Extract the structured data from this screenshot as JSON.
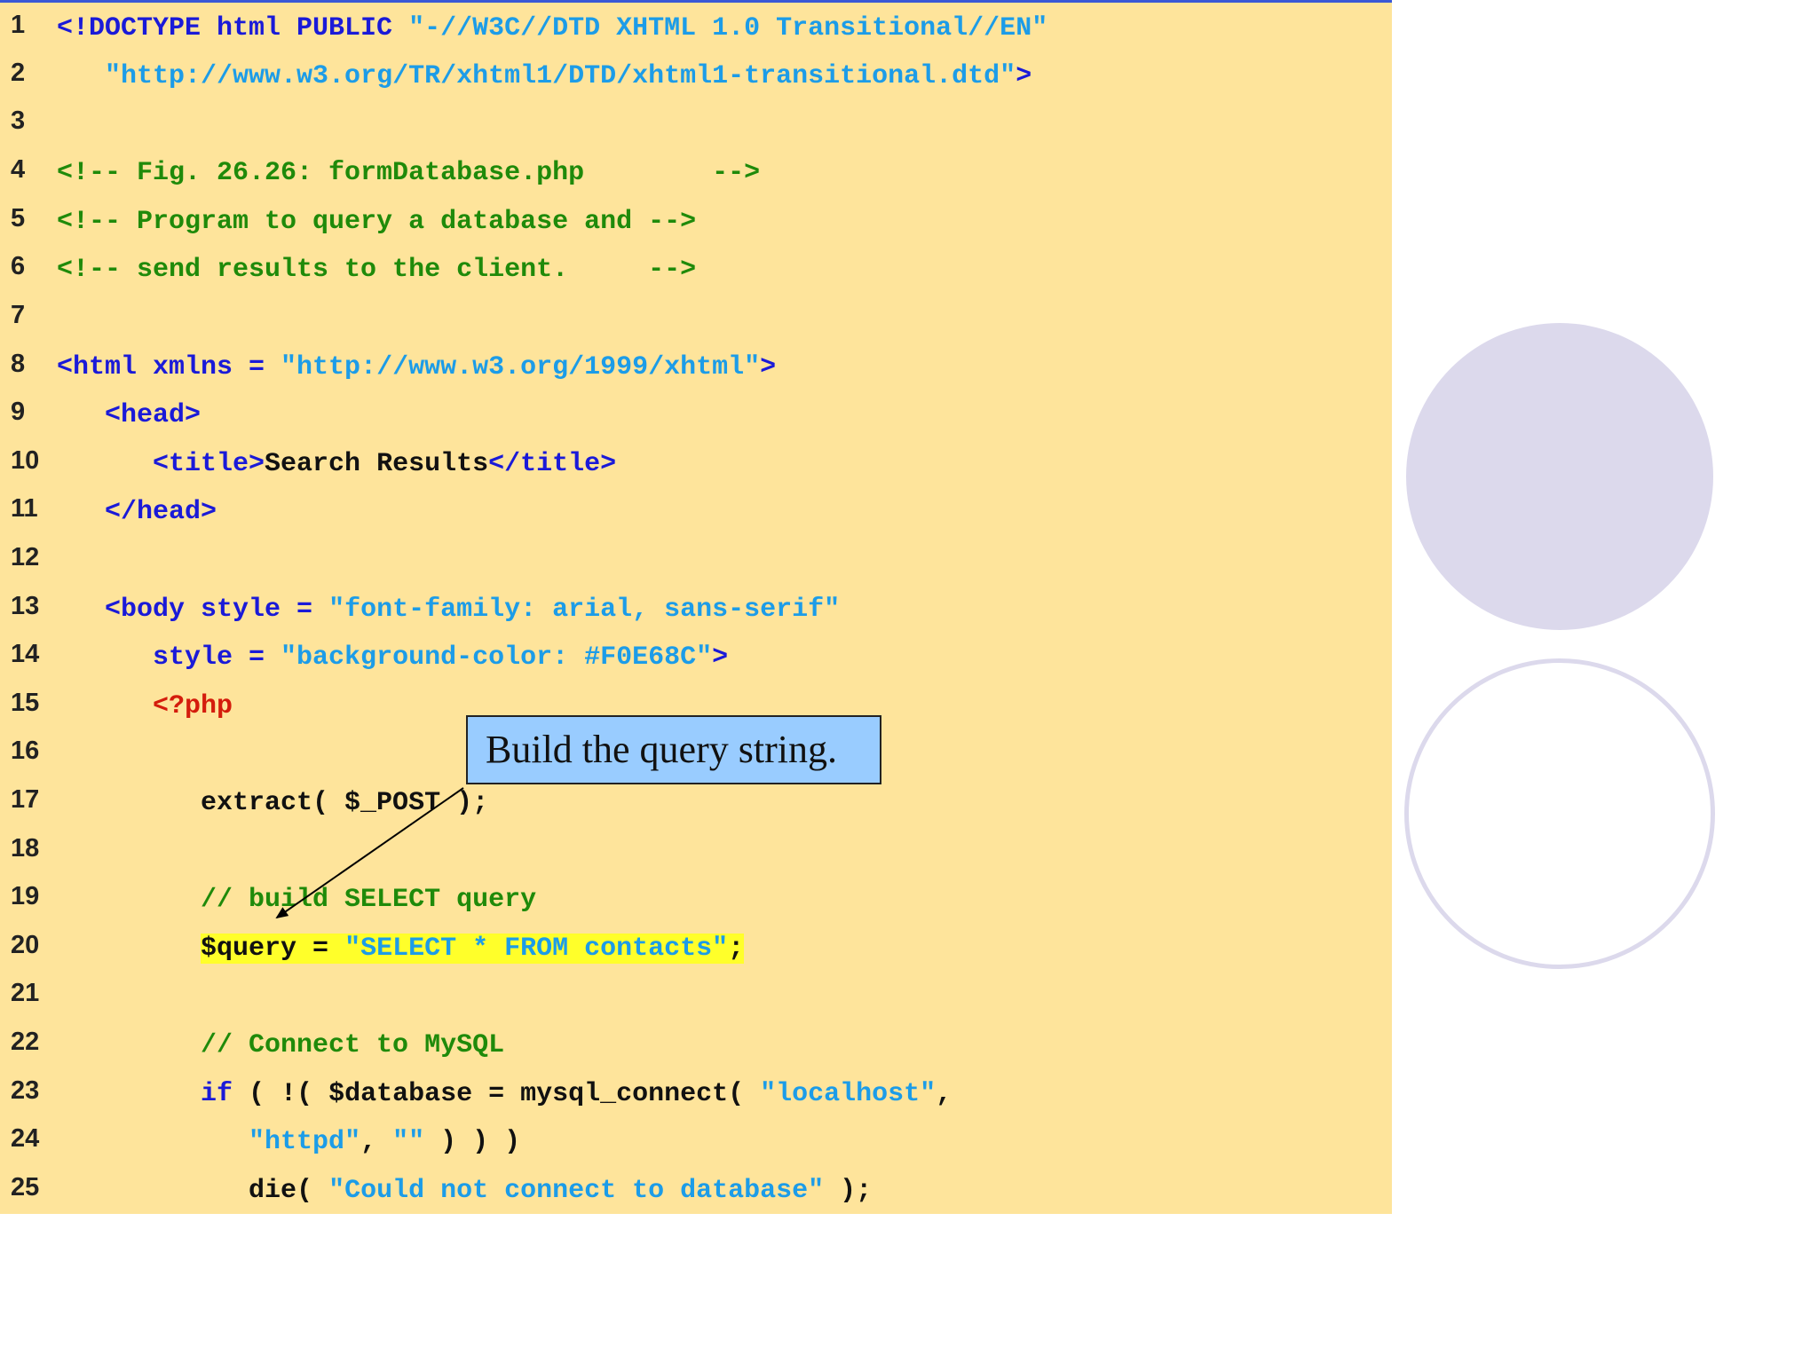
{
  "lines": [
    {
      "num": "1",
      "segments": [
        {
          "t": "<!DOCTYPE html PUBLIC ",
          "c": "tag"
        },
        {
          "t": "\"-//W3C//DTD XHTML 1.0 Transitional//EN\"",
          "c": "str"
        }
      ]
    },
    {
      "num": "2",
      "segments": [
        {
          "t": "   ",
          "c": "txt"
        },
        {
          "t": "\"http://www.w3.org/TR/xhtml1/DTD/xhtml1-transitional.dtd\"",
          "c": "str"
        },
        {
          "t": ">",
          "c": "tag"
        }
      ]
    },
    {
      "num": "3",
      "segments": []
    },
    {
      "num": "4",
      "segments": [
        {
          "t": "<!-- Fig. 26.26: formDatabase.php        -->",
          "c": "com"
        }
      ]
    },
    {
      "num": "5",
      "segments": [
        {
          "t": "<!-- Program to query a database and -->",
          "c": "com"
        }
      ]
    },
    {
      "num": "6",
      "segments": [
        {
          "t": "<!-- send results to the client.     -->",
          "c": "com"
        }
      ]
    },
    {
      "num": "7",
      "segments": []
    },
    {
      "num": "8",
      "segments": [
        {
          "t": "<html xmlns = ",
          "c": "tag"
        },
        {
          "t": "\"http://www.w3.org/1999/xhtml\"",
          "c": "str"
        },
        {
          "t": ">",
          "c": "tag"
        }
      ]
    },
    {
      "num": "9",
      "segments": [
        {
          "t": "   <head>",
          "c": "tag"
        }
      ]
    },
    {
      "num": "10",
      "segments": [
        {
          "t": "      <title>",
          "c": "tag"
        },
        {
          "t": "Search Results",
          "c": "txt"
        },
        {
          "t": "</title>",
          "c": "tag"
        }
      ]
    },
    {
      "num": "11",
      "segments": [
        {
          "t": "   </head>",
          "c": "tag"
        }
      ]
    },
    {
      "num": "12",
      "segments": []
    },
    {
      "num": "13",
      "segments": [
        {
          "t": "   <body style = ",
          "c": "tag"
        },
        {
          "t": "\"font-family: arial, sans-serif\"",
          "c": "str"
        }
      ]
    },
    {
      "num": "14",
      "segments": [
        {
          "t": "      style = ",
          "c": "tag"
        },
        {
          "t": "\"background-color: #F0E68C\"",
          "c": "str"
        },
        {
          "t": ">",
          "c": "tag"
        }
      ]
    },
    {
      "num": "15",
      "segments": [
        {
          "t": "      <?php",
          "c": "php"
        }
      ]
    },
    {
      "num": "16",
      "segments": []
    },
    {
      "num": "17",
      "segments": [
        {
          "t": "         extract( $_POST );",
          "c": "txt"
        }
      ]
    },
    {
      "num": "18",
      "segments": []
    },
    {
      "num": "19",
      "segments": [
        {
          "t": "         // build SELECT query",
          "c": "com"
        }
      ]
    },
    {
      "num": "20",
      "highlight": true,
      "segments": [
        {
          "t": "         ",
          "c": "txt",
          "nohl": true
        },
        {
          "t": "$query = ",
          "c": "txt"
        },
        {
          "t": "\"SELECT * FROM contacts\"",
          "c": "str"
        },
        {
          "t": ";",
          "c": "txt"
        }
      ]
    },
    {
      "num": "21",
      "segments": []
    },
    {
      "num": "22",
      "segments": [
        {
          "t": "         // Connect to MySQL",
          "c": "com"
        }
      ]
    },
    {
      "num": "23",
      "segments": [
        {
          "t": "         ",
          "c": "txt"
        },
        {
          "t": "if",
          "c": "tag"
        },
        {
          "t": " ( !( $database = mysql_connect( ",
          "c": "txt"
        },
        {
          "t": "\"localhost\"",
          "c": "str"
        },
        {
          "t": ",",
          "c": "txt"
        }
      ]
    },
    {
      "num": "24",
      "segments": [
        {
          "t": "            ",
          "c": "txt"
        },
        {
          "t": "\"httpd\"",
          "c": "str"
        },
        {
          "t": ", ",
          "c": "txt"
        },
        {
          "t": "\"\"",
          "c": "str"
        },
        {
          "t": " ) ) )",
          "c": "txt"
        }
      ]
    },
    {
      "num": "25",
      "segments": [
        {
          "t": "            die( ",
          "c": "txt"
        },
        {
          "t": "\"Could not connect to database\"",
          "c": "str"
        },
        {
          "t": " );",
          "c": "txt"
        }
      ]
    }
  ],
  "callout": {
    "text": "Build the query string."
  },
  "colors": {
    "panel_background": "#fee49b",
    "tag": "#1a1ad8",
    "string": "#1c9ce8",
    "comment": "#1f8a0a",
    "php": "#d41c0c",
    "highlight": "#ffff2a",
    "callout_fill": "#99ccff",
    "circle": "#dcd9ec"
  }
}
